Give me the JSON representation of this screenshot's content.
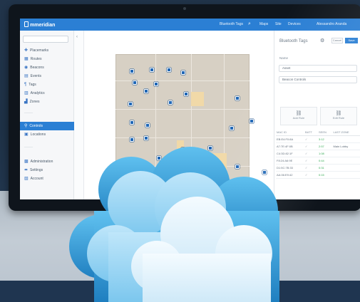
{
  "app": {
    "brand": "mmeridian",
    "top_nav": [
      "Bluetooth Tags",
      "Maps",
      "Site",
      "Devices",
      "Alessandro Aranda"
    ],
    "top_icons": [
      "search-icon",
      "user-icon"
    ]
  },
  "sidebar": {
    "items": [
      {
        "label": "Placemarks",
        "icon": "pin-icon"
      },
      {
        "label": "Routes",
        "icon": "route-icon"
      },
      {
        "label": "Beacons",
        "icon": "beacon-icon"
      },
      {
        "label": "Events",
        "icon": "calendar-icon"
      },
      {
        "label": "Tags",
        "icon": "tag-icon"
      },
      {
        "label": "Analytics",
        "icon": "chart-icon"
      },
      {
        "label": "Zones",
        "icon": "zone-icon"
      },
      {
        "label": "Controls",
        "icon": "control-icon",
        "active": true
      },
      {
        "label": "Locations",
        "icon": "location-icon"
      },
      {
        "label": "Administration",
        "icon": "admin-icon"
      },
      {
        "label": "Settings",
        "icon": "settings-icon"
      },
      {
        "label": "Account",
        "icon": "account-icon"
      }
    ]
  },
  "panel": {
    "title": "Bluetooth Tags",
    "cancel": "Cancel",
    "save": "Save",
    "section_label": "Name",
    "field_1": "Asset",
    "field_2": "Beacon Controls",
    "action_1": "Add Rule",
    "action_2": "Edit Rule",
    "table": {
      "headers": [
        "MAC ID",
        "BATT",
        "SEEN",
        "LAST ZONE"
      ],
      "rows": [
        [
          "EB:E4:F0:8A",
          "✓",
          "3:12",
          ""
        ],
        [
          "A7:7E:4F:0B",
          "✓",
          "2:57",
          "Main Lobby"
        ],
        [
          "C4:3D:82:1F",
          "✓",
          "1:08",
          ""
        ],
        [
          "F8:24:A6:9E",
          "✓",
          "0:44",
          ""
        ],
        [
          "D1:5C:7B:33",
          "✓",
          "0:31",
          ""
        ],
        [
          "AA:06:E9:42",
          "✓",
          "0:15",
          ""
        ]
      ]
    }
  },
  "colors": {
    "accent": "#2b7fd4",
    "marker": "#2067b6",
    "floor": "#d7d0c4",
    "highlight": "#f1d9a8",
    "cloud_light": "#dff1fb",
    "cloud_mid": "#8fd0f2",
    "cloud_dark": "#2a8fcd"
  }
}
